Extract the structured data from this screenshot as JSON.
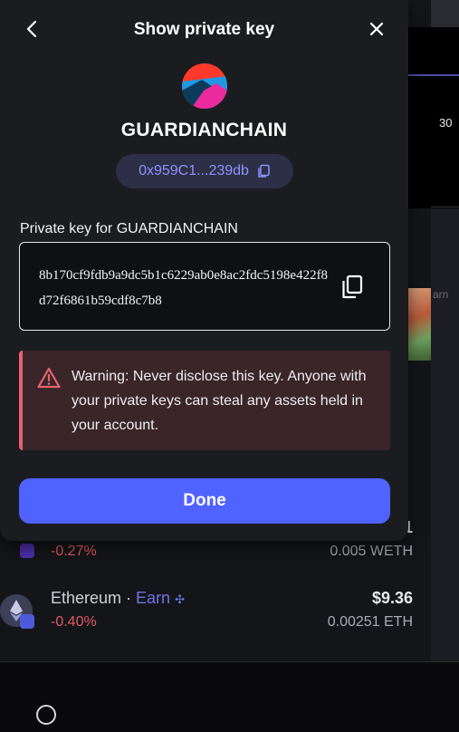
{
  "modal": {
    "title": "Show private key",
    "account_name": "GUARDIANCHAIN",
    "address_short": "0x959C1...239db",
    "private_key_label": "Private key for GUARDIANCHAIN",
    "private_key": "8b170cf9fdb9a9dc5b1c6229ab0e8ac2fdc5198e422f8d72f6861b59cdf8c7b8",
    "warning": "Warning: Never disclose this key. Anyone with your private keys can steal any assets held in your account.",
    "done_label": "Done",
    "colors": {
      "accent": "#5062ff",
      "warning_border": "#e56470",
      "warning_bg": "#3a2529",
      "address_text": "#8e93ff"
    },
    "icons": [
      "back-arrow-icon",
      "close-icon",
      "copy-icon",
      "warning-triangle-icon"
    ]
  },
  "background": {
    "chart_label": "30",
    "nft_text": "arn",
    "assets": [
      {
        "name": "",
        "earn": "",
        "change": "-0.27%",
        "value": "1",
        "amount": "0.005 WETH"
      },
      {
        "name": "Ethereum",
        "earn": "Earn",
        "change": "-0.40%",
        "value": "$9.36",
        "amount": "0.00251 ETH"
      }
    ],
    "colors": {
      "negative": "#e15a63",
      "earn": "#6f74e6"
    }
  }
}
